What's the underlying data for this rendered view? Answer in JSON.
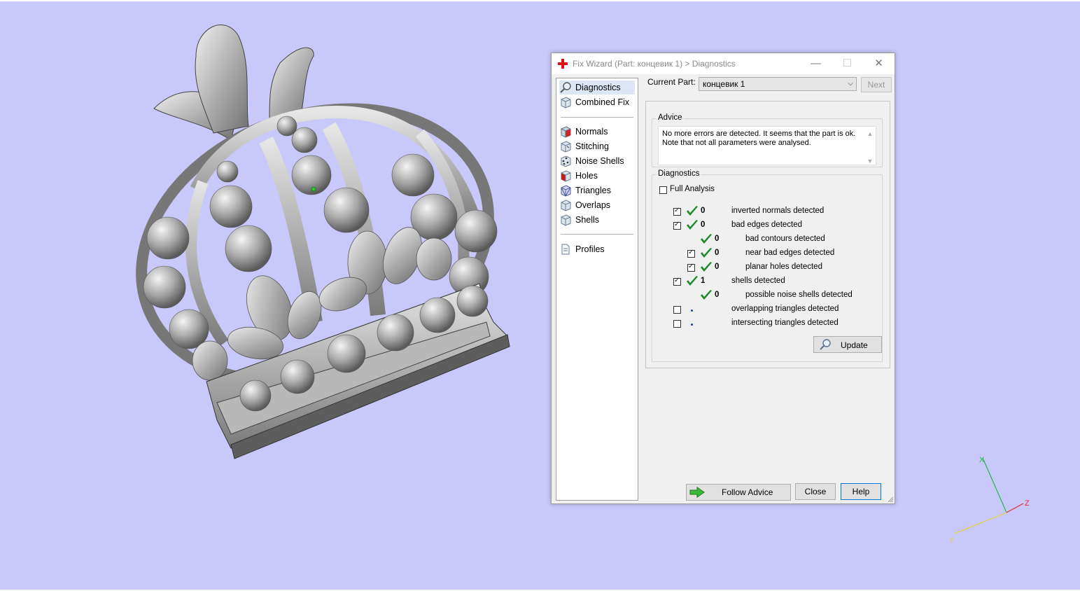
{
  "dialog": {
    "title": "Fix Wizard (Part: концевик 1) > Diagnostics",
    "window_buttons": {
      "minimize": "—",
      "maximize": "☐",
      "close": "✕"
    }
  },
  "sidebar": {
    "items": [
      {
        "label": "Diagnostics",
        "icon": "magnifier-icon",
        "selected": true
      },
      {
        "label": "Combined Fix",
        "icon": "cube-icon"
      },
      {
        "label": "Normals",
        "icon": "normals-cube-icon"
      },
      {
        "label": "Stitching",
        "icon": "stitching-cube-icon"
      },
      {
        "label": "Noise Shells",
        "icon": "noise-shells-icon"
      },
      {
        "label": "Holes",
        "icon": "holes-cube-icon"
      },
      {
        "label": "Triangles",
        "icon": "triangles-cube-icon"
      },
      {
        "label": "Overlaps",
        "icon": "overlaps-cube-icon"
      },
      {
        "label": "Shells",
        "icon": "shells-cube-icon"
      },
      {
        "label": "Profiles",
        "icon": "document-icon"
      }
    ]
  },
  "current_part": {
    "label": "Current Part:",
    "value": "концевик 1"
  },
  "next_button": "Next",
  "advice": {
    "title": "Advice",
    "text": "No more errors are detected. It seems that the part is ok. Note that not all parameters were analysed."
  },
  "diagnostics": {
    "title": "Diagnostics",
    "full_analysis": {
      "label": "Full Analysis",
      "checked": false
    },
    "rows": [
      {
        "checkbox": true,
        "checked": true,
        "status": "ok",
        "count": "0",
        "label": "inverted normals detected",
        "indent": 0
      },
      {
        "checkbox": true,
        "checked": true,
        "status": "ok",
        "count": "0",
        "label": "bad edges detected",
        "indent": 0
      },
      {
        "checkbox": false,
        "checked": false,
        "status": "ok",
        "count": "0",
        "label": "bad contours detected",
        "indent": 1
      },
      {
        "checkbox": true,
        "checked": true,
        "status": "ok",
        "count": "0",
        "label": "near bad edges detected",
        "indent": 1
      },
      {
        "checkbox": true,
        "checked": true,
        "status": "ok",
        "count": "0",
        "label": "planar holes detected",
        "indent": 1
      },
      {
        "checkbox": true,
        "checked": true,
        "status": "ok",
        "count": "1",
        "label": "shells detected",
        "indent": 0
      },
      {
        "checkbox": false,
        "checked": false,
        "status": "ok",
        "count": "0",
        "label": "possible noise shells detected",
        "indent": 1
      },
      {
        "checkbox": true,
        "checked": false,
        "status": "not-analysed",
        "count": "",
        "label": "overlapping triangles detected",
        "indent": 0
      },
      {
        "checkbox": true,
        "checked": false,
        "status": "not-analysed",
        "count": "",
        "label": "intersecting triangles detected",
        "indent": 0
      }
    ],
    "update_button": "Update"
  },
  "buttons": {
    "follow_advice": "Follow Advice",
    "close": "Close",
    "help": "Help"
  },
  "axes": {
    "x": "X",
    "y": "Y",
    "z": "Z"
  },
  "colors": {
    "viewport_background": "#c8c8fa",
    "ok_tick": "#1a8a2a",
    "axis_x": "#22bb44",
    "axis_y": "#e6d23a",
    "axis_z": "#e03030"
  }
}
